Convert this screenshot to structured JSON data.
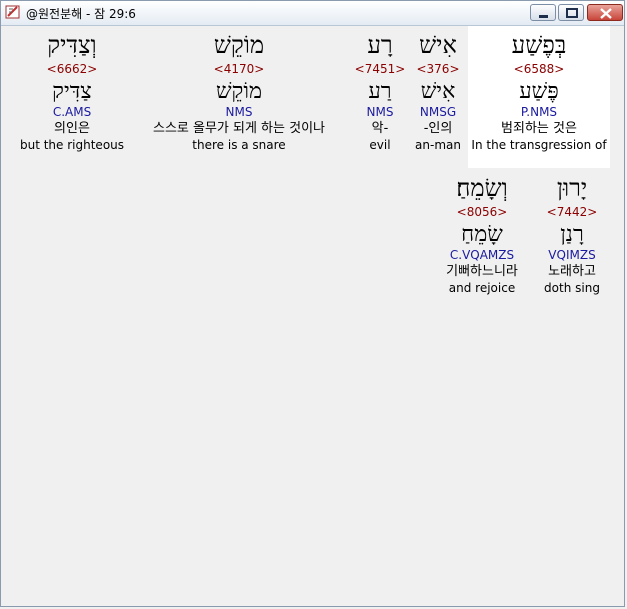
{
  "window": {
    "title": "@원전분해 - 잠 29:6"
  },
  "row1": [
    {
      "heb": "וְצַדִּיק",
      "strong": "<6662>",
      "lemma": "צַדִּיק",
      "morph": "C.AMS",
      "kor": "의인은",
      "eng": "but the righteous"
    },
    {
      "heb": "מוֹקֵשׁ",
      "strong": "<4170>",
      "lemma": "מוֹקֵשׁ",
      "morph": "NMS",
      "kor": "스스로 올무가 되게 하는 것이나",
      "eng": "there is a snare"
    },
    {
      "heb": "רָע",
      "strong": "<7451>",
      "lemma": "רַע",
      "morph": "NMS",
      "kor": "악-",
      "eng": "evil"
    },
    {
      "heb": "אִישׁ",
      "strong": "<376>",
      "lemma": "אִישׁ",
      "morph": "NMSG",
      "kor": "-인의",
      "eng": "an-man"
    },
    {
      "heb": "בְּפֶשַׁע",
      "strong": "<6588>",
      "lemma": "פֶּשַׁע",
      "morph": "P.NMS",
      "kor": "범죄하는 것은",
      "eng": "In the transgression of"
    }
  ],
  "row2": [
    {
      "heb": "וְשָׂמֵחַ׃",
      "strong": "<8056>",
      "lemma": "שָׂמֵחַ",
      "morph": "C.VQAMZS",
      "kor": "기뻐하느니라",
      "eng": "and rejoice"
    },
    {
      "heb": "יָרוּן",
      "strong": "<7442>",
      "lemma": "רָנַן",
      "morph": "VQIMZS",
      "kor": "노래하고",
      "eng": "doth sing"
    }
  ]
}
